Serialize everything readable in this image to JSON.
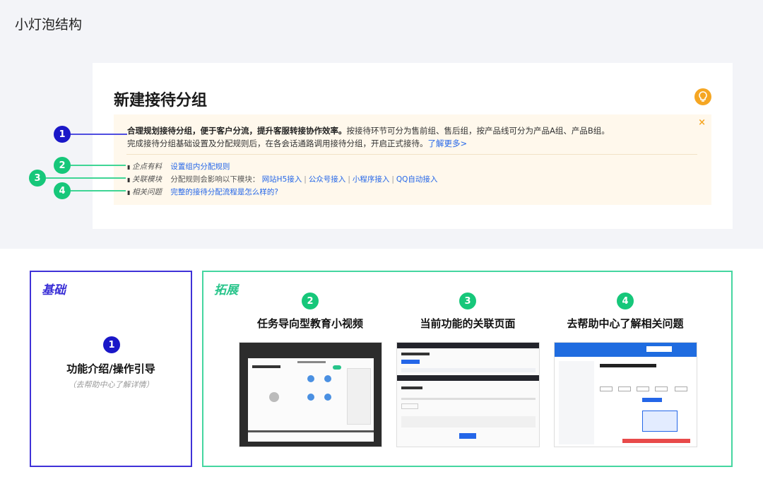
{
  "section_title": "小灯泡结构",
  "panel": {
    "title": "新建接待分组",
    "close_glyph": "×",
    "tip": {
      "line1_bold": "合理规划接待分组，便于客户分流，提升客服转接协作效率。",
      "line1_rest": "按接待环节可分为售前组、售后组，按产品线可分为产品A组、产品B组。",
      "line2_text": "完成接待分组基础设置及分配规则后，在各会话通路调用接待分组，开启正式接待。",
      "line2_link": "了解更多>"
    },
    "rows": [
      {
        "label": "企点有料",
        "links": [
          "设置组内分配规则"
        ]
      },
      {
        "label": "关联模块",
        "text": "分配规则会影响以下模块：",
        "links": [
          "网站H5接入",
          "公众号接入",
          "小程序接入",
          "QQ自动接入"
        ],
        "separator": "|"
      },
      {
        "label": "相关问题",
        "links": [
          "完整的接待分配流程是怎么样的?"
        ]
      }
    ]
  },
  "markers": [
    "1",
    "2",
    "3",
    "4"
  ],
  "basic": {
    "label": "基础",
    "marker": "1",
    "title": "功能介绍/操作引导",
    "subtitle": "（去帮助中心了解详情）"
  },
  "extension": {
    "label": "拓展",
    "columns": [
      {
        "marker": "2",
        "title": "任务导向型教育小视频"
      },
      {
        "marker": "3",
        "title": "当前功能的关联页面"
      },
      {
        "marker": "4",
        "title": "去帮助中心了解相关问题"
      }
    ]
  },
  "colors": {
    "top_bg": "#f3f4f8",
    "tip_bg": "#fff8ec",
    "marker_blue": "#1a17c8",
    "marker_green": "#16c77a",
    "bulb": "#f5a623",
    "link": "#2466e8"
  },
  "icons": [
    "bulb-icon",
    "close-icon"
  ]
}
